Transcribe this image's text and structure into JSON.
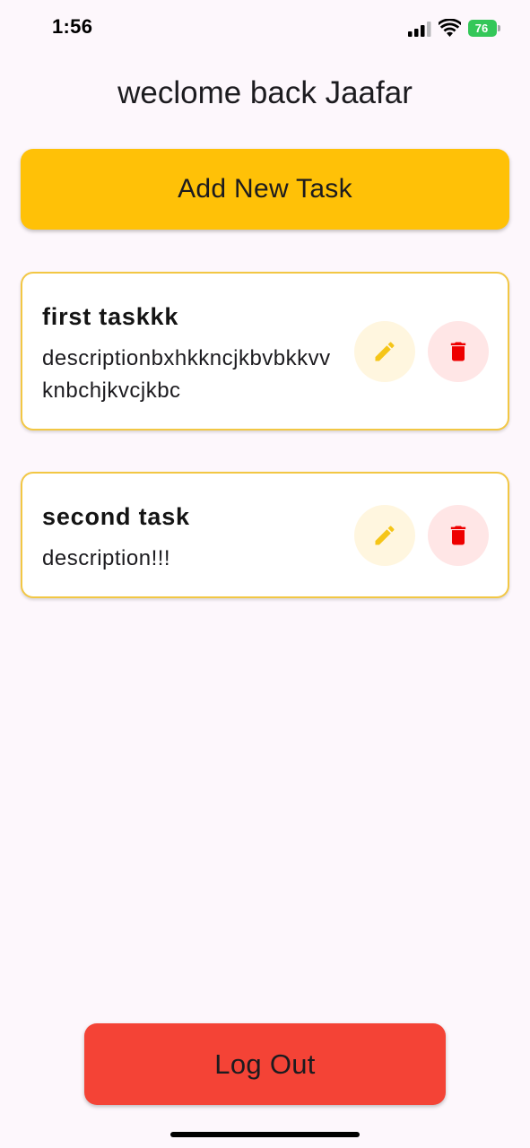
{
  "status_bar": {
    "time": "1:56",
    "battery_level": "76",
    "icons": [
      "cellular-signal-icon",
      "wifi-icon",
      "battery-charging-icon"
    ]
  },
  "header": {
    "title": "weclome back Jaafar"
  },
  "add_button": {
    "label": "Add New Task"
  },
  "tasks": [
    {
      "title": "first taskkk",
      "description": "descriptionbxhkkncjkbvbkkvvknbchjkvcjkbc",
      "actions": [
        "edit-icon",
        "delete-icon"
      ]
    },
    {
      "title": "second task",
      "description": "description!!!",
      "actions": [
        "edit-icon",
        "delete-icon"
      ]
    }
  ],
  "logout_button": {
    "label": "Log Out"
  },
  "colors": {
    "background": "#fdf7fc",
    "accent": "#ffc107",
    "card_border": "#f2c744",
    "edit_icon": "#f5c518",
    "delete_icon": "#ee0000",
    "logout": "#f44336",
    "battery": "#34c759"
  }
}
